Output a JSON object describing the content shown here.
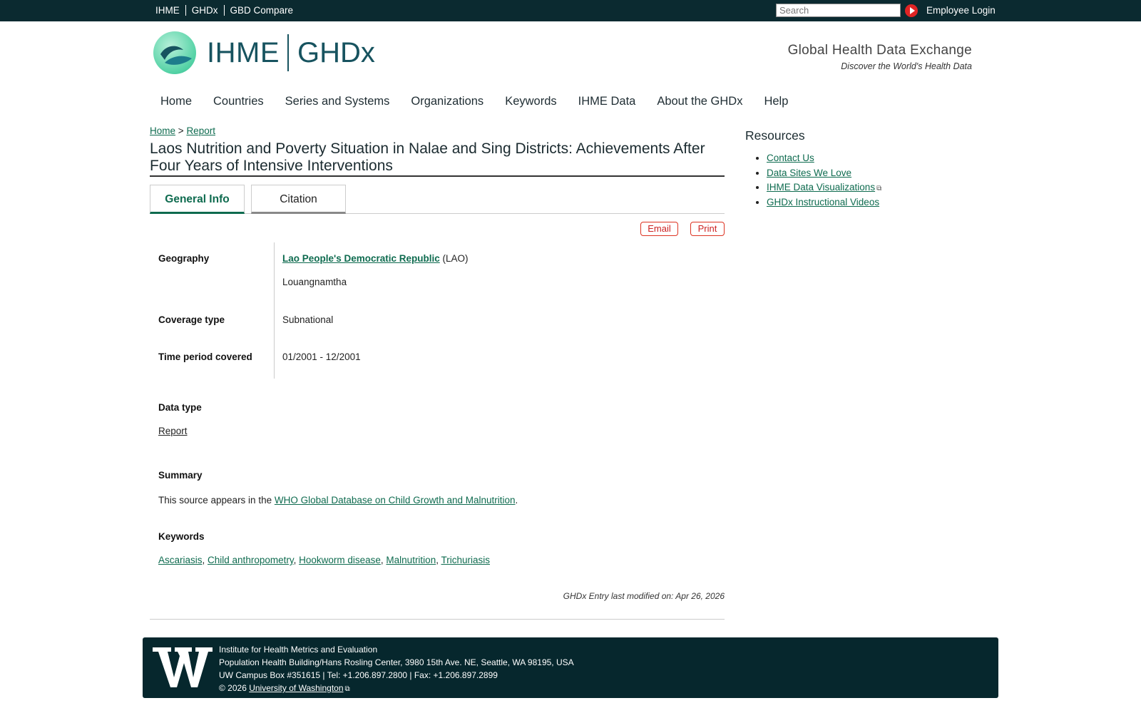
{
  "topbar": {
    "links": [
      "IHME",
      "GHDx",
      "GBD Compare"
    ],
    "search_placeholder": "Search",
    "login": "Employee Login"
  },
  "header": {
    "logo_left": "IHME",
    "logo_right": "GHDx",
    "tagline_title": "Global Health Data Exchange",
    "tagline_sub": "Discover the World's Health Data"
  },
  "nav": [
    "Home",
    "Countries",
    "Series and Systems",
    "Organizations",
    "Keywords",
    "IHME Data",
    "About the GHDx",
    "Help"
  ],
  "breadcrumb": {
    "home": "Home",
    "sep": ">",
    "current": "Report"
  },
  "page_title": "Laos Nutrition and Poverty Situation in Nalae and Sing Districts: Achievements After Four Years of Intensive Interventions",
  "tabs": {
    "general": "General Info",
    "citation": "Citation"
  },
  "actions": {
    "email": "Email",
    "print": "Print"
  },
  "fields": {
    "geography_label": "Geography",
    "geography_country": "Lao People's Democratic Republic",
    "geography_code": "(LAO)",
    "geography_region": "Louangnamtha",
    "coverage_label": "Coverage type",
    "coverage_value": "Subnational",
    "time_label": "Time period covered",
    "time_value": "01/2001 - 12/2001",
    "datatype_label": "Data type",
    "datatype_value": "Report",
    "summary_label": "Summary",
    "summary_prefix": "This source appears in the ",
    "summary_link": "WHO Global Database on Child Growth and Malnutrition",
    "summary_suffix": ".",
    "keywords_label": "Keywords",
    "keywords": [
      "Ascariasis",
      "Child anthropometry",
      "Hookworm disease",
      "Malnutrition",
      "Trichuriasis"
    ]
  },
  "modified": "GHDx Entry last modified on: Apr 26, 2026",
  "sidebar": {
    "title": "Resources",
    "links": [
      "Contact Us",
      "Data Sites We Love",
      "IHME Data Visualizations",
      "GHDx Instructional Videos"
    ]
  },
  "footer": {
    "line1": "Institute for Health Metrics and Evaluation",
    "line2": "Population Health Building/Hans Rosling Center, 3980 15th Ave. NE, Seattle, WA 98195, USA",
    "line3": "UW Campus Box #351615 | Tel: +1.206.897.2800 | Fax: +1.206.897.2899",
    "copyright": "© 2026",
    "uw_link": "University of Washington"
  }
}
